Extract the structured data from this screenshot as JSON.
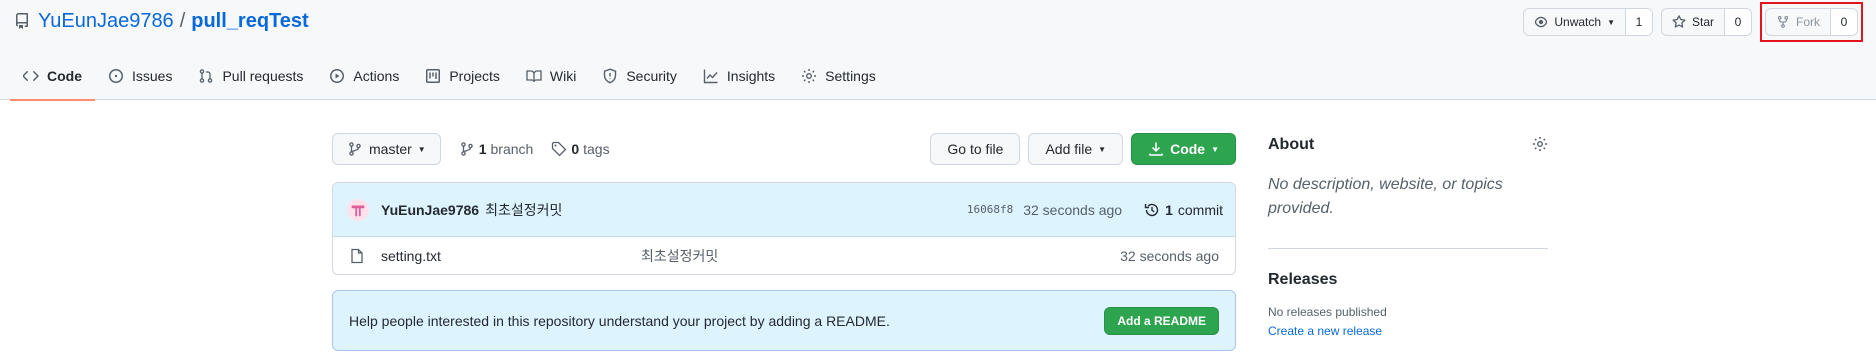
{
  "repo": {
    "owner": "YuEunJae9786",
    "separator": "/",
    "name": "pull_reqTest"
  },
  "actions": {
    "watch": {
      "label": "Unwatch",
      "count": "1"
    },
    "star": {
      "label": "Star",
      "count": "0"
    },
    "fork": {
      "label": "Fork",
      "count": "0"
    }
  },
  "tabs": [
    {
      "label": "Code",
      "icon": "code-icon",
      "active": true
    },
    {
      "label": "Issues",
      "icon": "issue-icon"
    },
    {
      "label": "Pull requests",
      "icon": "pull-request-icon"
    },
    {
      "label": "Actions",
      "icon": "play-icon"
    },
    {
      "label": "Projects",
      "icon": "project-icon"
    },
    {
      "label": "Wiki",
      "icon": "book-icon"
    },
    {
      "label": "Security",
      "icon": "shield-icon"
    },
    {
      "label": "Insights",
      "icon": "graph-icon"
    },
    {
      "label": "Settings",
      "icon": "gear-icon"
    }
  ],
  "toolbar": {
    "branch": "master",
    "branch_count": "1",
    "branch_label": "branch",
    "tag_count": "0",
    "tag_label": "tags",
    "go_to_file": "Go to file",
    "add_file": "Add file",
    "code": "Code"
  },
  "commit": {
    "author": "YuEunJae9786",
    "message": "최초설정커밋",
    "sha": "16068f8",
    "time": "32 seconds ago",
    "commit_count": "1",
    "commit_label": "commit"
  },
  "files": [
    {
      "name": "setting.txt",
      "message": "최초설정커밋",
      "time": "32 seconds ago"
    }
  ],
  "readme_prompt": {
    "text": "Help people interested in this repository understand your project by adding a README.",
    "button": "Add a README"
  },
  "about": {
    "title": "About",
    "description": "No description, website, or topics provided."
  },
  "releases": {
    "title": "Releases",
    "none": "No releases published",
    "create_link": "Create a new release"
  },
  "colors": {
    "primary_green": "#2da44e",
    "link_blue": "#0969da",
    "active_tab_underline": "#fd8c73",
    "highlight_box": "#e3141c"
  }
}
